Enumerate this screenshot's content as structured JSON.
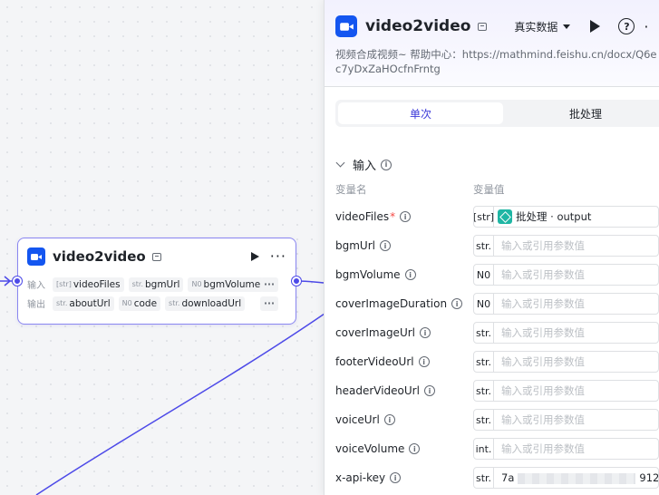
{
  "node": {
    "title": "video2video",
    "inputs_label": "输入",
    "outputs_label": "输出",
    "inputs": [
      {
        "type": "[str]",
        "name": "videoFiles"
      },
      {
        "type": "str.",
        "name": "bgmUrl"
      },
      {
        "type": "N0",
        "name": "bgmVolume"
      }
    ],
    "outputs": [
      {
        "type": "str.",
        "name": "aboutUrl"
      },
      {
        "type": "N0",
        "name": "code"
      },
      {
        "type": "str.",
        "name": "downloadUrl"
      }
    ],
    "more": "···",
    "accent": "#4d4ae8"
  },
  "panel": {
    "title": "video2video",
    "mode_select": "真实数据",
    "help": "?",
    "description": "视频合成视频~ 帮助中心：https://mathmind.feishu.cn/docx/Q6ec7yDxZaHOcfnFrntg",
    "tabs": [
      "单次",
      "批处理"
    ],
    "active_tab": 0,
    "section_title": "输入",
    "col_name": "变量名",
    "col_value": "变量值",
    "placeholder": "输入或引用参数值",
    "rows": [
      {
        "name": "videoFiles",
        "required": "*",
        "type": "[str]",
        "value": "批处理 · output",
        "kind": "ref"
      },
      {
        "name": "bgmUrl",
        "type": "str.",
        "value": "",
        "kind": "empty"
      },
      {
        "name": "bgmVolume",
        "type": "N0",
        "value": "",
        "kind": "empty"
      },
      {
        "name": "coverImageDuration",
        "type": "N0",
        "value": "",
        "kind": "empty"
      },
      {
        "name": "coverImageUrl",
        "type": "str.",
        "value": "",
        "kind": "empty"
      },
      {
        "name": "footerVideoUrl",
        "type": "str.",
        "value": "",
        "kind": "empty"
      },
      {
        "name": "headerVideoUrl",
        "type": "str.",
        "value": "",
        "kind": "empty"
      },
      {
        "name": "voiceUrl",
        "type": "str.",
        "value": "",
        "kind": "empty"
      },
      {
        "name": "voiceVolume",
        "type": "int.",
        "value": "",
        "kind": "empty"
      },
      {
        "name": "x-api-key",
        "type": "str.",
        "value_prefix": "7a",
        "value_suffix": "912",
        "kind": "masked"
      }
    ]
  },
  "icons": {
    "node_logo": "video-camera-icon",
    "robot": "robot-icon",
    "info": "info-icon",
    "batch": "layers-icon"
  }
}
